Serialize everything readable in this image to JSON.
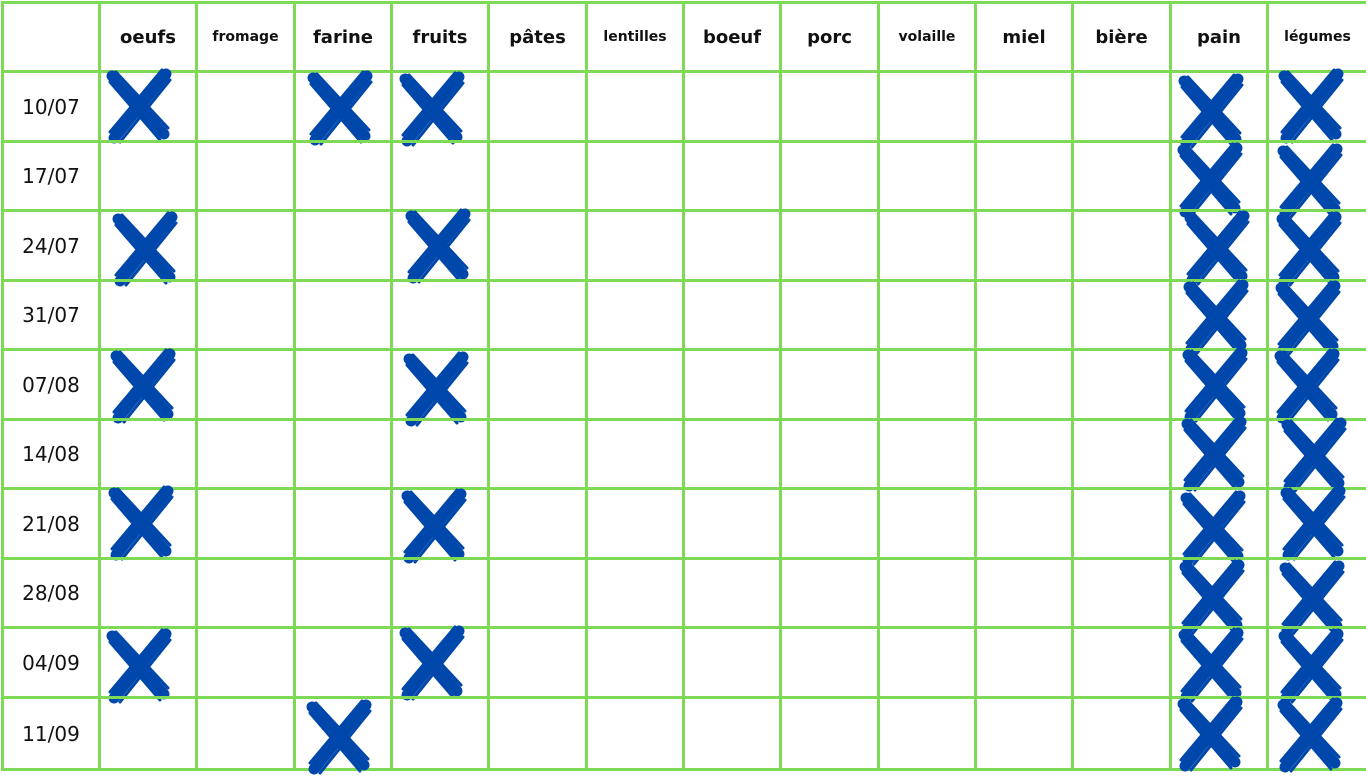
{
  "table": {
    "corner": "",
    "columns": [
      "oeufs",
      "fromage",
      "farine",
      "fruits",
      "pâtes",
      "lentilles",
      "boeuf",
      "porc",
      "volaille",
      "miel",
      "bière",
      "pain",
      "légumes"
    ],
    "small_columns": [
      "fromage",
      "lentilles",
      "volaille",
      "légumes"
    ],
    "rows": [
      {
        "date": "10/07",
        "checked": [
          "oeufs",
          "farine",
          "fruits",
          "pain",
          "légumes"
        ]
      },
      {
        "date": "17/07",
        "checked": [
          "pain",
          "légumes"
        ]
      },
      {
        "date": "24/07",
        "checked": [
          "oeufs",
          "fruits",
          "pain",
          "légumes"
        ]
      },
      {
        "date": "31/07",
        "checked": [
          "pain",
          "légumes"
        ]
      },
      {
        "date": "07/08",
        "checked": [
          "oeufs",
          "fruits",
          "pain",
          "légumes"
        ]
      },
      {
        "date": "14/08",
        "checked": [
          "pain",
          "légumes"
        ]
      },
      {
        "date": "21/08",
        "checked": [
          "oeufs",
          "fruits",
          "pain",
          "légumes"
        ]
      },
      {
        "date": "28/08",
        "checked": [
          "pain",
          "légumes"
        ]
      },
      {
        "date": "04/09",
        "checked": [
          "oeufs",
          "fruits",
          "pain",
          "légumes"
        ]
      },
      {
        "date": "11/09",
        "checked": [
          "farine",
          "pain",
          "légumes"
        ]
      }
    ],
    "mark_icon": "x-cross-mark-icon",
    "colors": {
      "grid": "#7ed957",
      "mark": "#0047ab"
    }
  }
}
